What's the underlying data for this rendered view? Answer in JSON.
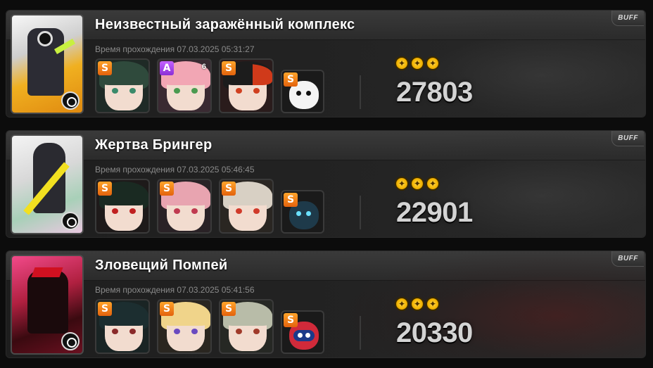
{
  "cards": [
    {
      "title": "Неизвестный заражённый комплекс",
      "time": "Время прохождения 07.03.2025 05:31:27",
      "buff_label": "BUFF",
      "score": "27803",
      "stars": 3,
      "agents": [
        {
          "rank": "S",
          "level": ""
        },
        {
          "rank": "A",
          "level": "6"
        },
        {
          "rank": "S",
          "level": ""
        }
      ],
      "bangboo": {
        "rank": "S"
      }
    },
    {
      "title": "Жертва Брингер",
      "time": "Время прохождения 07.03.2025 05:46:45",
      "buff_label": "BUFF",
      "score": "22901",
      "stars": 3,
      "agents": [
        {
          "rank": "S",
          "level": ""
        },
        {
          "rank": "S",
          "level": ""
        },
        {
          "rank": "S",
          "level": ""
        }
      ],
      "bangboo": {
        "rank": "S"
      }
    },
    {
      "title": "Зловещий Помпей",
      "time": "Время прохождения 07.03.2025 05:41:56",
      "buff_label": "BUFF",
      "score": "20330",
      "stars": 3,
      "agents": [
        {
          "rank": "S",
          "level": ""
        },
        {
          "rank": "S",
          "level": ""
        },
        {
          "rank": "S",
          "level": ""
        }
      ],
      "bangboo": {
        "rank": "S"
      }
    }
  ],
  "colors": {
    "rank_s": "#f07a14",
    "rank_a": "#a94be8",
    "star": "#f2b300",
    "score": "#d4d4d4"
  }
}
